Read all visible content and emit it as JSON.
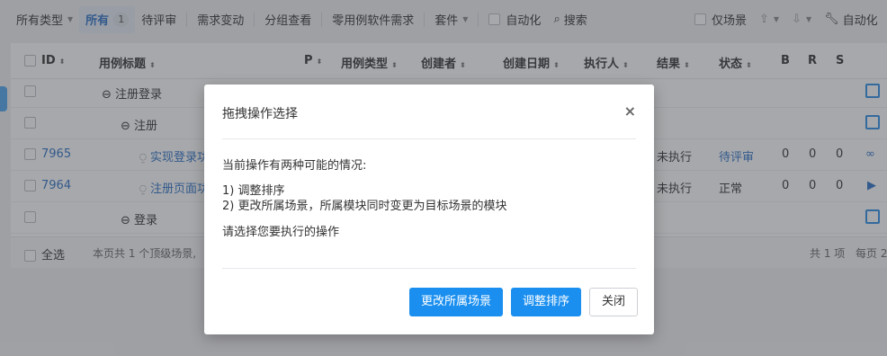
{
  "toolbar": {
    "all_types": "所有类型",
    "all": "所有",
    "all_count": "1",
    "pending_review": "待评审",
    "requirement_change": "需求变动",
    "group_view": "分组查看",
    "zero_case_req": "零用例软件需求",
    "suite": "套件",
    "automation": "自动化",
    "search": "搜索",
    "scene_only": "仅场景",
    "auto_exec": "自动化"
  },
  "table": {
    "headers": {
      "id": "ID",
      "title": "用例标题",
      "p": "P",
      "case_type": "用例类型",
      "creator": "创建者",
      "created_date": "创建日期",
      "executor": "执行人",
      "result": "结果",
      "status": "状态",
      "b": "B",
      "r": "R",
      "s": "S"
    },
    "rows": [
      {
        "id": "",
        "title": "注册登录",
        "result": "",
        "status": "",
        "b": "",
        "r": "",
        "s": ""
      },
      {
        "id": "",
        "title": "注册",
        "result": "",
        "status": "",
        "b": "",
        "r": "",
        "s": ""
      },
      {
        "id": "7965",
        "title": "实现登录功",
        "result": "未执行",
        "status": "待评审",
        "b": "0",
        "r": "0",
        "s": "0"
      },
      {
        "id": "7964",
        "title": "注册页面功",
        "result": "未执行",
        "status": "正常",
        "b": "0",
        "r": "0",
        "s": "0"
      },
      {
        "id": "",
        "title": "登录",
        "result": "",
        "status": "",
        "b": "",
        "r": "",
        "s": ""
      }
    ],
    "footer": {
      "select_all": "全选",
      "summary": "本页共 1 个顶级场景,",
      "total": "共 1 项",
      "per_page": "每页 2"
    }
  },
  "modal": {
    "title": "拖拽操作选择",
    "close": "×",
    "line1": "当前操作有两种可能的情况:",
    "line2": "1) 调整排序",
    "line3": "2) 更改所属场景，所属模块同时变更为目标场景的模块",
    "line4": "请选择您要执行的操作",
    "btn_change_scene": "更改所属场景",
    "btn_reorder": "调整排序",
    "btn_close": "关闭"
  },
  "colors": {
    "primary": "#1a8ff0",
    "link": "#2c72c6",
    "overlay": "rgba(60,63,68,0.45)"
  }
}
